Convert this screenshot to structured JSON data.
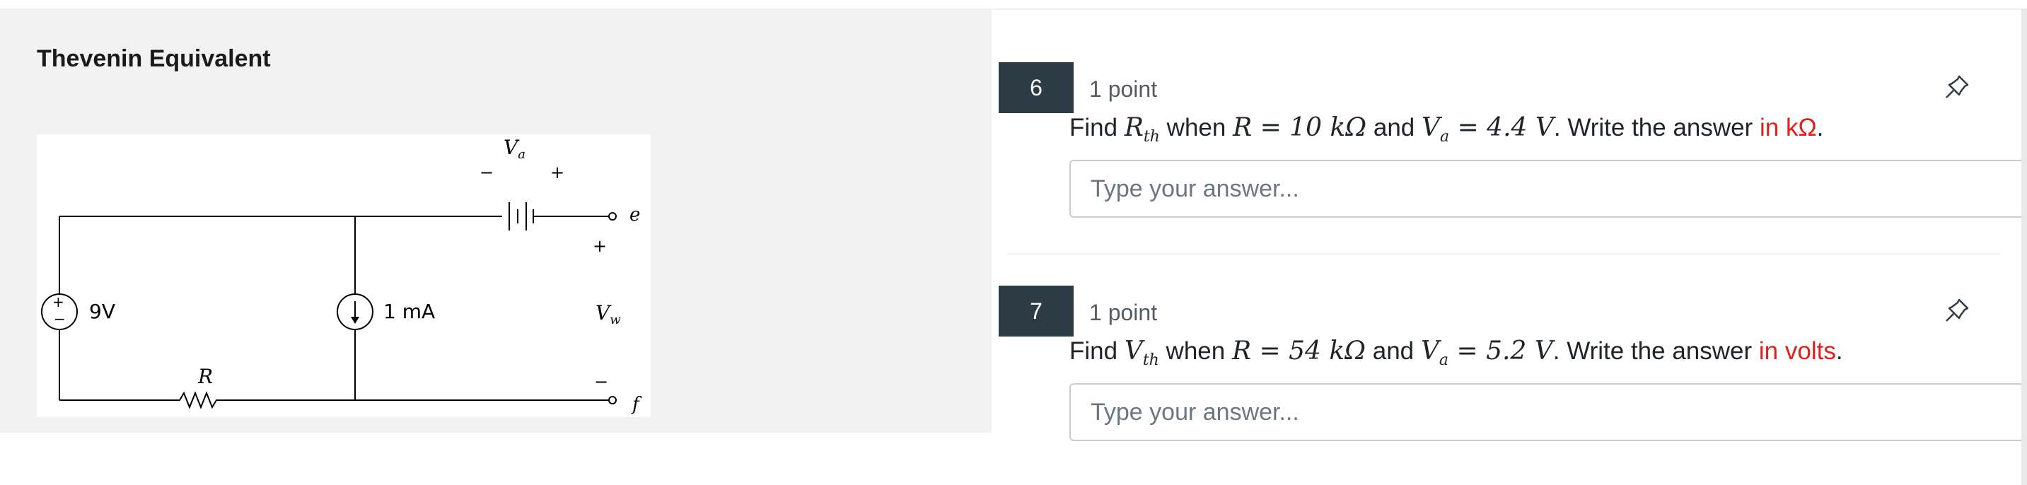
{
  "section": {
    "title": "Thevenin Equivalent"
  },
  "circuit": {
    "source_voltage_label": "9V",
    "current_source_label": "1 mA",
    "resistor_label": "R",
    "battery_label_base": "V",
    "battery_label_sub": "a",
    "battery_minus": "−",
    "battery_plus": "+",
    "terminal_e": "e",
    "terminal_f": "f",
    "vw_label_base": "V",
    "vw_label_sub": "w",
    "vw_plus": "+",
    "vw_minus": "−"
  },
  "questions": [
    {
      "number": "6",
      "points": "1 point",
      "find": "Find ",
      "target_base": "R",
      "target_sub": "th",
      "when": " when ",
      "r_eq": "R = 10 kΩ",
      "and": " and ",
      "va_eq": "V",
      "va_sub": "a",
      "va_val": " = 4.4 V",
      "dot_write": ". Write the answer ",
      "unit_note": "in kΩ",
      "end": ".",
      "placeholder": "Type your answer..."
    },
    {
      "number": "7",
      "points": "1 point",
      "find": "Find ",
      "target_base": "V",
      "target_sub": "th",
      "when": " when ",
      "r_eq": "R = 54 kΩ",
      "and": " and ",
      "va_eq": "V",
      "va_sub": "a",
      "va_val": " = 5.2 V",
      "dot_write": ". Write the answer ",
      "unit_note": "in volts",
      "end": ".",
      "placeholder": "Type your answer..."
    }
  ],
  "icons": {
    "pin": "pin-icon"
  }
}
